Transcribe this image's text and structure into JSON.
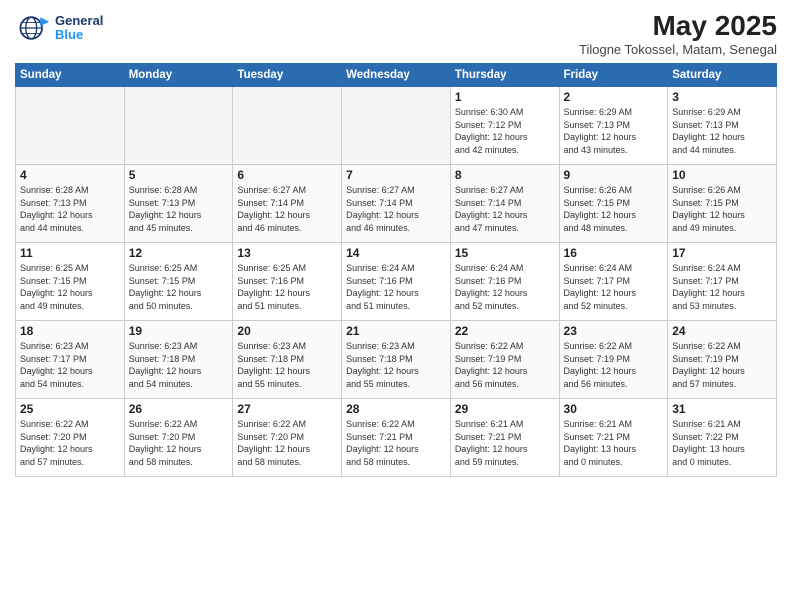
{
  "header": {
    "logo_line1": "General",
    "logo_line2": "Blue",
    "month_year": "May 2025",
    "location": "Tilogne Tokossel, Matam, Senegal"
  },
  "days_of_week": [
    "Sunday",
    "Monday",
    "Tuesday",
    "Wednesday",
    "Thursday",
    "Friday",
    "Saturday"
  ],
  "weeks": [
    [
      {
        "day": "",
        "info": ""
      },
      {
        "day": "",
        "info": ""
      },
      {
        "day": "",
        "info": ""
      },
      {
        "day": "",
        "info": ""
      },
      {
        "day": "1",
        "info": "Sunrise: 6:30 AM\nSunset: 7:12 PM\nDaylight: 12 hours\nand 42 minutes."
      },
      {
        "day": "2",
        "info": "Sunrise: 6:29 AM\nSunset: 7:13 PM\nDaylight: 12 hours\nand 43 minutes."
      },
      {
        "day": "3",
        "info": "Sunrise: 6:29 AM\nSunset: 7:13 PM\nDaylight: 12 hours\nand 44 minutes."
      }
    ],
    [
      {
        "day": "4",
        "info": "Sunrise: 6:28 AM\nSunset: 7:13 PM\nDaylight: 12 hours\nand 44 minutes."
      },
      {
        "day": "5",
        "info": "Sunrise: 6:28 AM\nSunset: 7:13 PM\nDaylight: 12 hours\nand 45 minutes."
      },
      {
        "day": "6",
        "info": "Sunrise: 6:27 AM\nSunset: 7:14 PM\nDaylight: 12 hours\nand 46 minutes."
      },
      {
        "day": "7",
        "info": "Sunrise: 6:27 AM\nSunset: 7:14 PM\nDaylight: 12 hours\nand 46 minutes."
      },
      {
        "day": "8",
        "info": "Sunrise: 6:27 AM\nSunset: 7:14 PM\nDaylight: 12 hours\nand 47 minutes."
      },
      {
        "day": "9",
        "info": "Sunrise: 6:26 AM\nSunset: 7:15 PM\nDaylight: 12 hours\nand 48 minutes."
      },
      {
        "day": "10",
        "info": "Sunrise: 6:26 AM\nSunset: 7:15 PM\nDaylight: 12 hours\nand 49 minutes."
      }
    ],
    [
      {
        "day": "11",
        "info": "Sunrise: 6:25 AM\nSunset: 7:15 PM\nDaylight: 12 hours\nand 49 minutes."
      },
      {
        "day": "12",
        "info": "Sunrise: 6:25 AM\nSunset: 7:15 PM\nDaylight: 12 hours\nand 50 minutes."
      },
      {
        "day": "13",
        "info": "Sunrise: 6:25 AM\nSunset: 7:16 PM\nDaylight: 12 hours\nand 51 minutes."
      },
      {
        "day": "14",
        "info": "Sunrise: 6:24 AM\nSunset: 7:16 PM\nDaylight: 12 hours\nand 51 minutes."
      },
      {
        "day": "15",
        "info": "Sunrise: 6:24 AM\nSunset: 7:16 PM\nDaylight: 12 hours\nand 52 minutes."
      },
      {
        "day": "16",
        "info": "Sunrise: 6:24 AM\nSunset: 7:17 PM\nDaylight: 12 hours\nand 52 minutes."
      },
      {
        "day": "17",
        "info": "Sunrise: 6:24 AM\nSunset: 7:17 PM\nDaylight: 12 hours\nand 53 minutes."
      }
    ],
    [
      {
        "day": "18",
        "info": "Sunrise: 6:23 AM\nSunset: 7:17 PM\nDaylight: 12 hours\nand 54 minutes."
      },
      {
        "day": "19",
        "info": "Sunrise: 6:23 AM\nSunset: 7:18 PM\nDaylight: 12 hours\nand 54 minutes."
      },
      {
        "day": "20",
        "info": "Sunrise: 6:23 AM\nSunset: 7:18 PM\nDaylight: 12 hours\nand 55 minutes."
      },
      {
        "day": "21",
        "info": "Sunrise: 6:23 AM\nSunset: 7:18 PM\nDaylight: 12 hours\nand 55 minutes."
      },
      {
        "day": "22",
        "info": "Sunrise: 6:22 AM\nSunset: 7:19 PM\nDaylight: 12 hours\nand 56 minutes."
      },
      {
        "day": "23",
        "info": "Sunrise: 6:22 AM\nSunset: 7:19 PM\nDaylight: 12 hours\nand 56 minutes."
      },
      {
        "day": "24",
        "info": "Sunrise: 6:22 AM\nSunset: 7:19 PM\nDaylight: 12 hours\nand 57 minutes."
      }
    ],
    [
      {
        "day": "25",
        "info": "Sunrise: 6:22 AM\nSunset: 7:20 PM\nDaylight: 12 hours\nand 57 minutes."
      },
      {
        "day": "26",
        "info": "Sunrise: 6:22 AM\nSunset: 7:20 PM\nDaylight: 12 hours\nand 58 minutes."
      },
      {
        "day": "27",
        "info": "Sunrise: 6:22 AM\nSunset: 7:20 PM\nDaylight: 12 hours\nand 58 minutes."
      },
      {
        "day": "28",
        "info": "Sunrise: 6:22 AM\nSunset: 7:21 PM\nDaylight: 12 hours\nand 58 minutes."
      },
      {
        "day": "29",
        "info": "Sunrise: 6:21 AM\nSunset: 7:21 PM\nDaylight: 12 hours\nand 59 minutes."
      },
      {
        "day": "30",
        "info": "Sunrise: 6:21 AM\nSunset: 7:21 PM\nDaylight: 13 hours\nand 0 minutes."
      },
      {
        "day": "31",
        "info": "Sunrise: 6:21 AM\nSunset: 7:22 PM\nDaylight: 13 hours\nand 0 minutes."
      }
    ]
  ]
}
